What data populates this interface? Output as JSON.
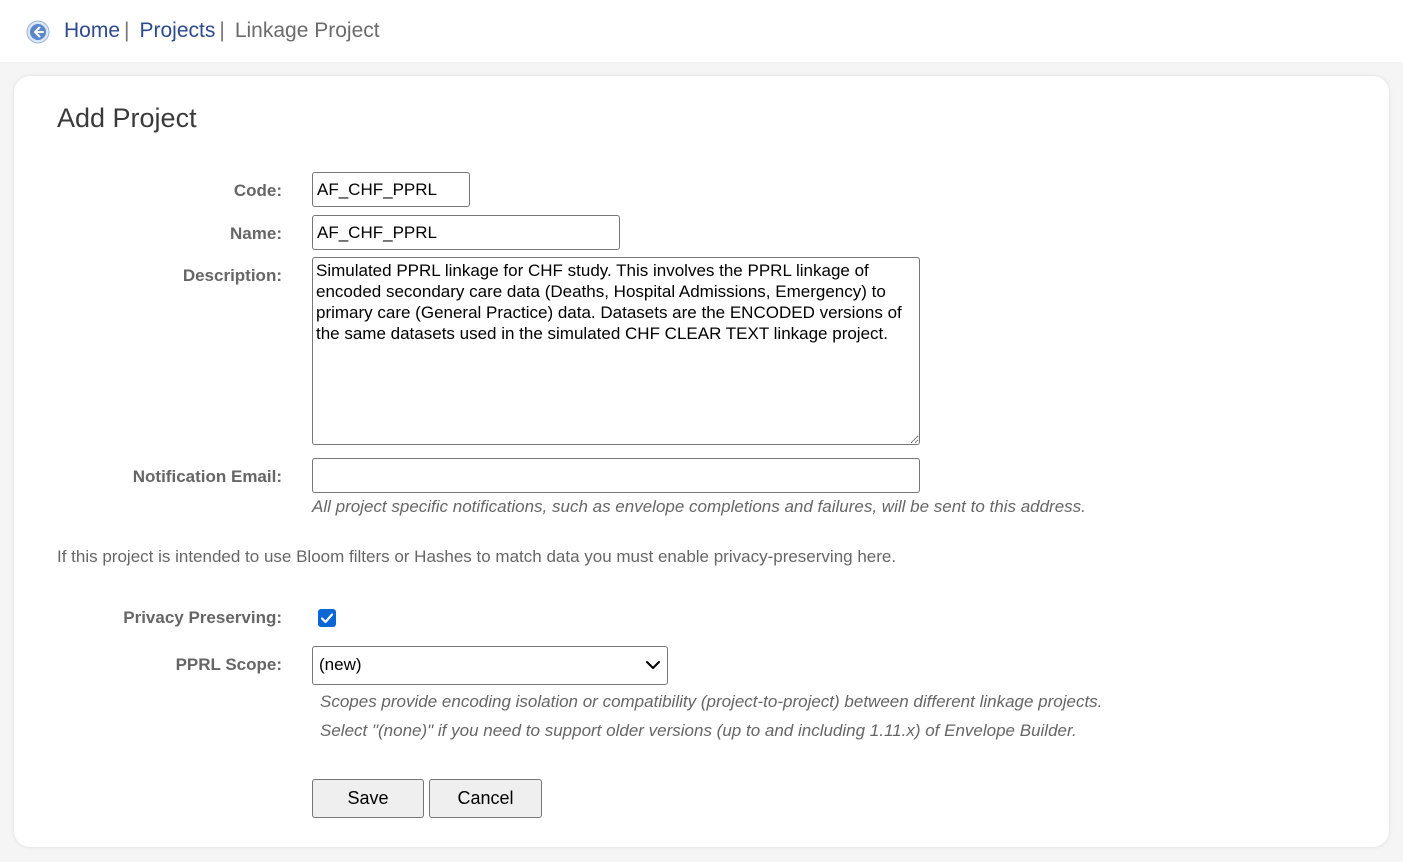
{
  "breadcrumb": {
    "back_icon": "back-arrow-icon",
    "items": [
      {
        "label": "Home",
        "link": true
      },
      {
        "label": "Projects",
        "link": true
      },
      {
        "label": "Linkage Project",
        "link": false
      }
    ],
    "separator": "|"
  },
  "form": {
    "title": "Add Project",
    "code": {
      "label": "Code:",
      "value": "AF_CHF_PPRL"
    },
    "name": {
      "label": "Name:",
      "value": "AF_CHF_PPRL"
    },
    "description": {
      "label": "Description:",
      "value": "Simulated PPRL linkage for CHF study. This involves the PPRL linkage of encoded secondary care data (Deaths, Hospital Admissions, Emergency) to primary care (General Practice) data. Datasets are the ENCODED versions of the same datasets used in the simulated CHF CLEAR TEXT linkage project."
    },
    "notification_email": {
      "label": "Notification Email:",
      "value": "",
      "hint": "All project specific notifications, such as envelope completions and failures, will be sent to this address."
    },
    "privacy_info": "If this project is intended to use Bloom filters or Hashes to match data you must enable privacy-preserving here.",
    "privacy_preserving": {
      "label": "Privacy Preserving:",
      "checked": true
    },
    "pprl_scope": {
      "label": "PPRL Scope:",
      "selected": "(new)",
      "hint1": "Scopes provide encoding isolation or compatibility (project-to-project) between different linkage projects.",
      "hint2": "Select \"(none)\" if you need to support older versions (up to and including 1.11.x) of Envelope Builder."
    },
    "save_label": "Save",
    "cancel_label": "Cancel"
  },
  "colors": {
    "link": "#2d4a8f",
    "checkbox": "#0b67d6",
    "label": "#666666",
    "panel_bg": "#ffffff",
    "page_bg": "#f5f5f5"
  }
}
